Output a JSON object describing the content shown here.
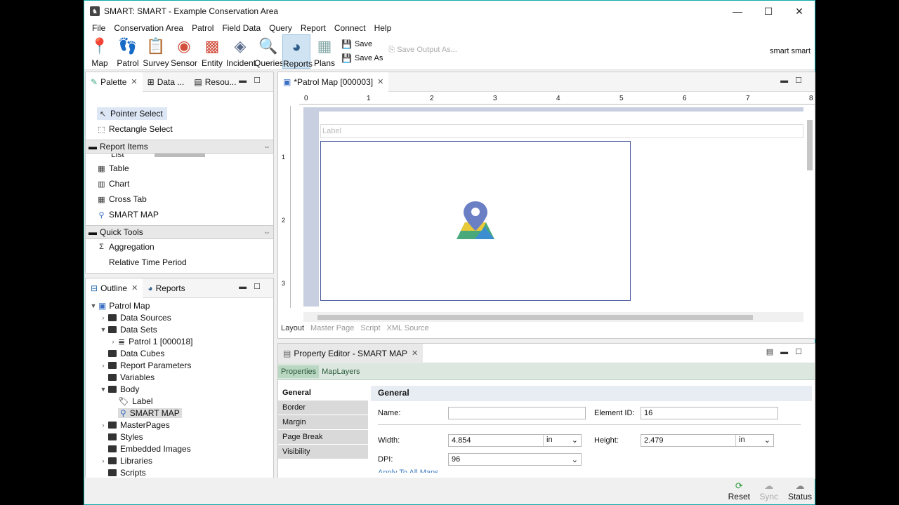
{
  "window": {
    "title": "SMART: SMART - Example Conservation Area"
  },
  "menu": [
    "File",
    "Conservation Area",
    "Patrol",
    "Field Data",
    "Query",
    "Report",
    "Connect",
    "Help"
  ],
  "toolbar": {
    "buttons": [
      "Map",
      "Patrol",
      "Survey",
      "Sensor",
      "Entity",
      "Incident",
      "Queries",
      "Reports",
      "Plans"
    ],
    "save": "Save",
    "save_as": "Save As",
    "save_output": "Save Output As...",
    "user": "smart smart"
  },
  "palette": {
    "tabs": [
      "Palette",
      "Data ...",
      "Resou..."
    ],
    "tools": [
      "Pointer Select",
      "Rectangle Select"
    ],
    "report_items_header": "Report Items",
    "report_items_partial": "List",
    "report_items": [
      "Table",
      "Chart",
      "Cross Tab",
      "SMART MAP"
    ],
    "quick_tools_header": "Quick Tools",
    "quick_tools": [
      "Aggregation",
      "Relative Time Period"
    ]
  },
  "outline": {
    "tabs": [
      "Outline",
      "Reports"
    ],
    "root": "Patrol Map",
    "nodes": [
      "Data Sources",
      "Data Sets",
      "Patrol 1 [000018]",
      "Data Cubes",
      "Report Parameters",
      "Variables",
      "Body",
      "Label",
      "SMART MAP",
      "MasterPages",
      "Styles",
      "Embedded Images",
      "Libraries",
      "Scripts"
    ]
  },
  "editor": {
    "tab": "*Patrol Map [000003]",
    "ruler": [
      "0",
      "1",
      "2",
      "3",
      "4",
      "5",
      "6",
      "7",
      "8"
    ],
    "ruler_v": [
      "1",
      "2",
      "3"
    ],
    "label_placeholder": "Label",
    "bottom_tabs": [
      "Layout",
      "Master Page",
      "Script",
      "XML Source"
    ]
  },
  "property_editor": {
    "title": "Property Editor - SMART MAP",
    "tabs": [
      "Properties",
      "MapLayers"
    ],
    "categories": [
      "General",
      "Border",
      "Margin",
      "Page Break",
      "Visibility"
    ],
    "section": "General",
    "name_label": "Name:",
    "name_value": "",
    "element_id_label": "Element ID:",
    "element_id_value": "16",
    "width_label": "Width:",
    "width_value": "4.854",
    "width_unit": "in",
    "height_label": "Height:",
    "height_value": "2.479",
    "height_unit": "in",
    "dpi_label": "DPI:",
    "dpi_value": "96",
    "apply_link": "Apply To All Maps"
  },
  "status": {
    "reset": "Reset",
    "sync": "Sync",
    "status": "Status"
  }
}
